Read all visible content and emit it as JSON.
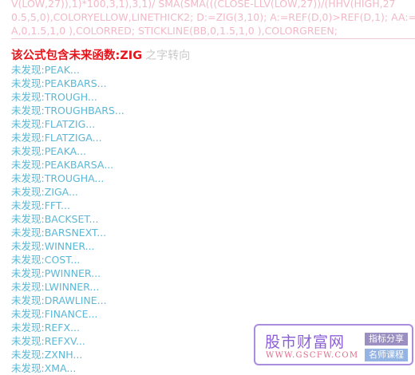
{
  "code": {
    "lines": [
      "V(LOW,27)),1)*100,3,1),3,1)/ SMA(SMA(((CLOSE-LLV(LOW,27))/(HHV(HIGH,27",
      "0.5,5,0),COLORYELLOW,LINETHICK2; D:=ZIG(3,10); A:=REF(D,0)>REF(D,1); AA:=REF",
      "A,0,1.5,1,0 ),COLORRED; STICKLINE(BB,0,1.5,1,0 ),COLORGREEN;"
    ]
  },
  "warning": {
    "main": "该公式包含未来函数:ZIG",
    "suffix": "之字转向"
  },
  "missing_functions": [
    "未发现:PEAK...",
    "未发现:PEAKBARS...",
    "未发现:TROUGH...",
    "未发现:TROUGHBARS...",
    "未发现:FLATZIG...",
    "未发现:FLATZIGA...",
    "未发现:PEAKA...",
    "未发现:PEAKBARSA...",
    "未发现:TROUGHA...",
    "未发现:ZIGA...",
    "未发现:FFT...",
    "未发现:BACKSET...",
    "未发现:BARSNEXT...",
    "未发现:WINNER...",
    "未发现:COST...",
    "未发现:PWINNER...",
    "未发现:LWINNER...",
    "未发现:DRAWLINE...",
    "未发现:FINANCE...",
    "未发现:REFX...",
    "未发现:REFXV...",
    "未发现:ZXNH...",
    "未发现:XMA..."
  ],
  "watermark": {
    "logo": "股市财富网",
    "url": "WWW.GSCFW.COM",
    "badge1": "指标分享",
    "badge2": "名师课程"
  },
  "colors": {
    "code": "#f2b8c8",
    "warning": "#e8141a",
    "missing": "#5bb8d6",
    "watermark_border": "#a98ee0"
  }
}
